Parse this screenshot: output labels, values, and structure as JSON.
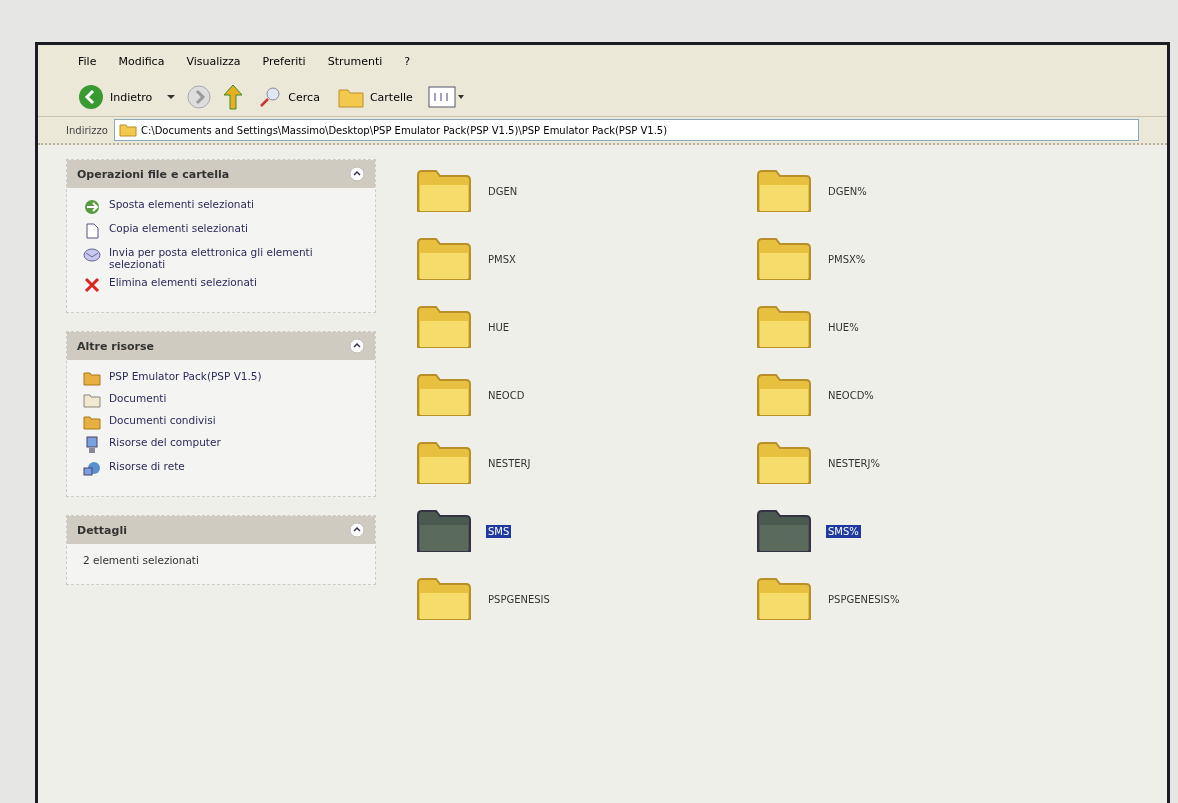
{
  "menu": [
    "File",
    "Modifica",
    "Visualizza",
    "Preferiti",
    "Strumenti",
    "?"
  ],
  "toolbar": {
    "back": "Indietro",
    "search": "Cerca",
    "folders": "Cartelle"
  },
  "address": {
    "label": "Indirizzo",
    "value": "C:\\Documents and Settings\\Massimo\\Desktop\\PSP Emulator Pack(PSP V1.5)\\PSP Emulator Pack(PSP V1.5)"
  },
  "panels": [
    {
      "title": "Operazioni file e cartella",
      "items": [
        {
          "kind": "move",
          "label": "Sposta elementi selezionati"
        },
        {
          "kind": "copy",
          "label": "Copia elementi selezionati"
        },
        {
          "kind": "mail",
          "label": "Invia per posta elettronica gli elementi selezionati"
        },
        {
          "kind": "delete",
          "label": "Elimina elementi selezionati"
        }
      ]
    },
    {
      "title": "Altre risorse",
      "items": [
        {
          "kind": "folder",
          "label": "PSP Emulator Pack(PSP V1.5)"
        },
        {
          "kind": "documents",
          "label": "Documenti"
        },
        {
          "kind": "folder",
          "label": "Documenti condivisi"
        },
        {
          "kind": "computer",
          "label": "Risorse del computer"
        },
        {
          "kind": "network",
          "label": "Risorse di rete"
        }
      ]
    },
    {
      "title": "Dettagli",
      "items": [
        {
          "kind": "text",
          "label": "2 elementi selezionati"
        }
      ]
    }
  ],
  "folders": [
    {
      "name": "DGEN",
      "selected": false
    },
    {
      "name": "DGEN%",
      "selected": false
    },
    {
      "name": "PMSX",
      "selected": false
    },
    {
      "name": "PMSX%",
      "selected": false
    },
    {
      "name": "HUE",
      "selected": false
    },
    {
      "name": "HUE%",
      "selected": false
    },
    {
      "name": "NEOCD",
      "selected": false
    },
    {
      "name": "NEOCD%",
      "selected": false
    },
    {
      "name": "NESTERJ",
      "selected": false
    },
    {
      "name": "NESTERJ%",
      "selected": false
    },
    {
      "name": "SMS",
      "selected": true
    },
    {
      "name": "SMS%",
      "selected": true
    },
    {
      "name": "PSPGENESIS",
      "selected": false
    },
    {
      "name": "PSPGENESIS%",
      "selected": false
    }
  ]
}
